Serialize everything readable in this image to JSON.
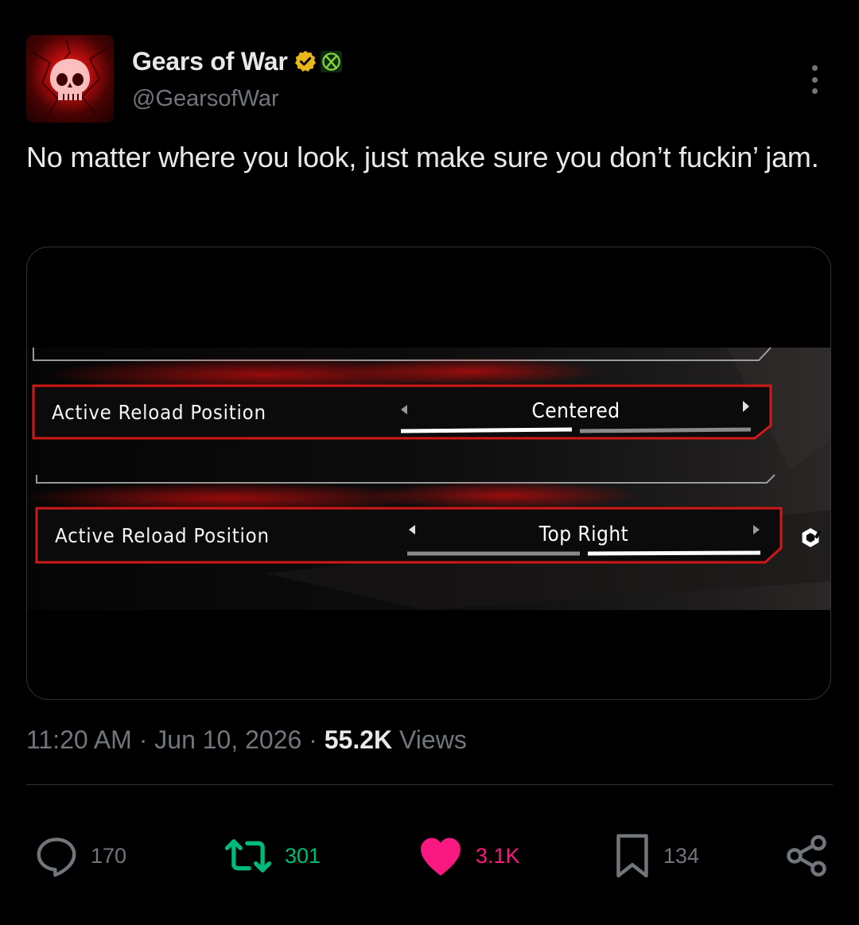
{
  "author": {
    "display_name": "Gears of War",
    "handle": "@GearsofWar",
    "avatar_icon": "skull-omen-icon",
    "verified_icon": "verified-badge-icon",
    "affiliate_icon": "xbox-icon"
  },
  "tweet": {
    "text": "No matter where you look, just make sure you don’t fuckin’ jam."
  },
  "media": {
    "settings_rows": [
      {
        "label": "Active Reload Position",
        "value": "Centered",
        "selected_segment": 1,
        "segments": 2
      },
      {
        "label": "Active Reload Position",
        "value": "Top Right",
        "selected_segment": 2,
        "segments": 2
      }
    ],
    "changed_indicator_icon": "gear-changed-icon"
  },
  "meta": {
    "time": "11:20 AM",
    "separator": "·",
    "date": "Jun 10, 2026",
    "views_count": "55.2K",
    "views_label": "Views"
  },
  "actions": {
    "replies": "170",
    "reposts": "301",
    "likes": "3.1K",
    "bookmarks": "134"
  },
  "colors": {
    "background": "#000000",
    "text_primary": "#e7e9ea",
    "text_secondary": "#71767b",
    "repost_green": "#00ba7c",
    "like_pink": "#f91880",
    "verified_gold": "#e8b71a",
    "game_red": "#d11818"
  }
}
